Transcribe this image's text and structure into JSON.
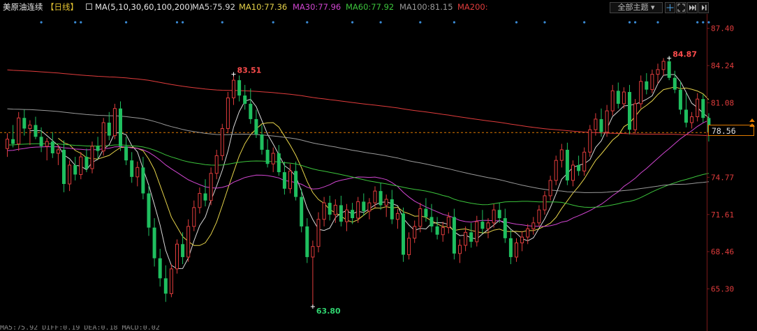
{
  "header": {
    "instrument": "美原油连续",
    "period": "【日线】",
    "ma_params": "MA(5,10,30,60,100,200)",
    "ma_values": [
      {
        "label": "MA5:75.92",
        "color": "#d8d8d8"
      },
      {
        "label": "MA10:77.36",
        "color": "#e6d34a"
      },
      {
        "label": "MA30:77.96",
        "color": "#d146d1"
      },
      {
        "label": "MA60:77.92",
        "color": "#3cc43c"
      },
      {
        "label": "MA100:81.15",
        "color": "#9a9a9a"
      },
      {
        "label": "MA200:",
        "color": "#e03c3c"
      }
    ],
    "theme_button": "全部主题",
    "theme_arrow": "▾",
    "icons": [
      "crosshair-icon",
      "expand-icon",
      "fast-forward-icon",
      "step-forward-icon"
    ]
  },
  "chart_data": {
    "type": "candlestick",
    "ylim": [
      62.5,
      88.5
    ],
    "y_ticks": [
      "87.40",
      "84.24",
      "81.08",
      "78.56",
      "74.77",
      "71.61",
      "68.46",
      "65.30"
    ],
    "last_price": "78.56",
    "high_annotation": {
      "label": "84.87",
      "index": 117,
      "value": 84.87
    },
    "high_annotation_2": {
      "label": "83.51",
      "index": 40,
      "value": 83.51
    },
    "low_annotation": {
      "label": "63.80",
      "index": 54,
      "value": 63.8
    },
    "candles": [
      {
        "o": 77.2,
        "h": 78.5,
        "l": 76.5,
        "c": 78.0
      },
      {
        "o": 78.0,
        "h": 79.2,
        "l": 77.3,
        "c": 77.6
      },
      {
        "o": 77.6,
        "h": 80.3,
        "l": 77.0,
        "c": 79.8
      },
      {
        "o": 79.8,
        "h": 80.5,
        "l": 78.3,
        "c": 78.9
      },
      {
        "o": 78.9,
        "h": 79.6,
        "l": 77.5,
        "c": 79.2
      },
      {
        "o": 79.2,
        "h": 79.9,
        "l": 78.0,
        "c": 78.2
      },
      {
        "o": 78.2,
        "h": 79.0,
        "l": 76.9,
        "c": 77.4
      },
      {
        "o": 77.4,
        "h": 78.1,
        "l": 76.2,
        "c": 77.8
      },
      {
        "o": 77.8,
        "h": 78.6,
        "l": 76.4,
        "c": 76.8
      },
      {
        "o": 76.8,
        "h": 77.5,
        "l": 75.8,
        "c": 77.1
      },
      {
        "o": 77.1,
        "h": 77.9,
        "l": 73.5,
        "c": 74.2
      },
      {
        "o": 74.2,
        "h": 76.2,
        "l": 73.6,
        "c": 75.8
      },
      {
        "o": 75.8,
        "h": 76.5,
        "l": 74.5,
        "c": 75.0
      },
      {
        "o": 75.0,
        "h": 76.9,
        "l": 74.6,
        "c": 76.5
      },
      {
        "o": 76.5,
        "h": 77.2,
        "l": 75.2,
        "c": 75.5
      },
      {
        "o": 75.5,
        "h": 77.8,
        "l": 75.1,
        "c": 77.4
      },
      {
        "o": 77.4,
        "h": 78.2,
        "l": 76.3,
        "c": 77.0
      },
      {
        "o": 77.0,
        "h": 79.8,
        "l": 76.6,
        "c": 79.4
      },
      {
        "o": 79.4,
        "h": 80.3,
        "l": 77.9,
        "c": 78.3
      },
      {
        "o": 78.3,
        "h": 81.0,
        "l": 78.0,
        "c": 80.6
      },
      {
        "o": 80.6,
        "h": 81.2,
        "l": 77.0,
        "c": 77.4
      },
      {
        "o": 77.4,
        "h": 78.2,
        "l": 75.8,
        "c": 76.2
      },
      {
        "o": 76.2,
        "h": 76.9,
        "l": 74.3,
        "c": 74.8
      },
      {
        "o": 74.8,
        "h": 76.1,
        "l": 74.0,
        "c": 75.6
      },
      {
        "o": 75.6,
        "h": 76.5,
        "l": 72.9,
        "c": 73.4
      },
      {
        "o": 73.4,
        "h": 74.1,
        "l": 69.8,
        "c": 70.5
      },
      {
        "o": 70.5,
        "h": 71.3,
        "l": 67.2,
        "c": 67.9
      },
      {
        "o": 67.9,
        "h": 68.7,
        "l": 65.5,
        "c": 66.2
      },
      {
        "o": 66.2,
        "h": 67.3,
        "l": 64.2,
        "c": 64.9
      },
      {
        "o": 64.9,
        "h": 67.4,
        "l": 64.6,
        "c": 67.0
      },
      {
        "o": 67.0,
        "h": 69.5,
        "l": 66.6,
        "c": 69.1
      },
      {
        "o": 69.1,
        "h": 70.1,
        "l": 67.4,
        "c": 68.0
      },
      {
        "o": 68.0,
        "h": 71.2,
        "l": 67.6,
        "c": 70.6
      },
      {
        "o": 70.6,
        "h": 72.8,
        "l": 70.2,
        "c": 72.2
      },
      {
        "o": 72.2,
        "h": 73.9,
        "l": 71.7,
        "c": 73.4
      },
      {
        "o": 73.4,
        "h": 74.6,
        "l": 72.3,
        "c": 72.8
      },
      {
        "o": 72.8,
        "h": 75.6,
        "l": 72.4,
        "c": 75.1
      },
      {
        "o": 75.1,
        "h": 77.1,
        "l": 74.6,
        "c": 76.6
      },
      {
        "o": 76.6,
        "h": 79.3,
        "l": 76.2,
        "c": 78.9
      },
      {
        "o": 78.9,
        "h": 82.0,
        "l": 78.5,
        "c": 81.5
      },
      {
        "o": 81.5,
        "h": 83.51,
        "l": 80.9,
        "c": 83.0
      },
      {
        "o": 83.0,
        "h": 83.4,
        "l": 81.2,
        "c": 81.7
      },
      {
        "o": 81.7,
        "h": 82.6,
        "l": 80.5,
        "c": 81.0
      },
      {
        "o": 81.0,
        "h": 82.3,
        "l": 79.3,
        "c": 79.7
      },
      {
        "o": 79.7,
        "h": 80.5,
        "l": 78.1,
        "c": 78.4
      },
      {
        "o": 78.4,
        "h": 79.2,
        "l": 76.7,
        "c": 77.1
      },
      {
        "o": 77.1,
        "h": 78.0,
        "l": 75.6,
        "c": 75.9
      },
      {
        "o": 75.9,
        "h": 77.3,
        "l": 75.2,
        "c": 76.8
      },
      {
        "o": 76.8,
        "h": 77.5,
        "l": 74.9,
        "c": 75.2
      },
      {
        "o": 75.2,
        "h": 76.1,
        "l": 73.3,
        "c": 73.8
      },
      {
        "o": 73.8,
        "h": 75.9,
        "l": 73.4,
        "c": 75.3
      },
      {
        "o": 75.3,
        "h": 76.1,
        "l": 72.8,
        "c": 73.1
      },
      {
        "o": 73.1,
        "h": 73.8,
        "l": 70.1,
        "c": 70.6
      },
      {
        "o": 70.6,
        "h": 71.3,
        "l": 67.5,
        "c": 68.0
      },
      {
        "o": 68.0,
        "h": 69.4,
        "l": 63.8,
        "c": 68.9
      },
      {
        "o": 68.9,
        "h": 71.8,
        "l": 68.4,
        "c": 71.2
      },
      {
        "o": 71.2,
        "h": 73.1,
        "l": 70.6,
        "c": 72.6
      },
      {
        "o": 72.6,
        "h": 73.2,
        "l": 71.1,
        "c": 71.6
      },
      {
        "o": 71.6,
        "h": 72.9,
        "l": 70.9,
        "c": 72.4
      },
      {
        "o": 72.4,
        "h": 73.2,
        "l": 70.6,
        "c": 71.0
      },
      {
        "o": 71.0,
        "h": 72.5,
        "l": 70.2,
        "c": 72.0
      },
      {
        "o": 72.0,
        "h": 72.6,
        "l": 70.8,
        "c": 71.3
      },
      {
        "o": 71.3,
        "h": 73.1,
        "l": 70.9,
        "c": 72.7
      },
      {
        "o": 72.7,
        "h": 73.4,
        "l": 71.5,
        "c": 71.9
      },
      {
        "o": 71.9,
        "h": 73.0,
        "l": 71.2,
        "c": 72.6
      },
      {
        "o": 72.6,
        "h": 74.0,
        "l": 72.2,
        "c": 73.6
      },
      {
        "o": 73.6,
        "h": 74.3,
        "l": 72.0,
        "c": 72.4
      },
      {
        "o": 72.4,
        "h": 73.3,
        "l": 71.4,
        "c": 72.9
      },
      {
        "o": 72.9,
        "h": 73.7,
        "l": 70.8,
        "c": 71.2
      },
      {
        "o": 71.2,
        "h": 72.1,
        "l": 70.4,
        "c": 71.7
      },
      {
        "o": 71.7,
        "h": 72.2,
        "l": 67.6,
        "c": 68.2
      },
      {
        "o": 68.2,
        "h": 70.1,
        "l": 67.8,
        "c": 69.6
      },
      {
        "o": 69.6,
        "h": 71.1,
        "l": 69.2,
        "c": 70.6
      },
      {
        "o": 70.6,
        "h": 72.6,
        "l": 70.1,
        "c": 72.1
      },
      {
        "o": 72.1,
        "h": 73.0,
        "l": 71.0,
        "c": 71.4
      },
      {
        "o": 71.4,
        "h": 72.5,
        "l": 70.1,
        "c": 70.6
      },
      {
        "o": 70.6,
        "h": 71.4,
        "l": 69.5,
        "c": 69.9
      },
      {
        "o": 69.9,
        "h": 71.0,
        "l": 69.3,
        "c": 70.5
      },
      {
        "o": 70.5,
        "h": 71.8,
        "l": 70.0,
        "c": 71.4
      },
      {
        "o": 71.4,
        "h": 72.1,
        "l": 67.8,
        "c": 68.3
      },
      {
        "o": 68.3,
        "h": 69.5,
        "l": 67.5,
        "c": 69.0
      },
      {
        "o": 69.0,
        "h": 70.6,
        "l": 68.5,
        "c": 70.1
      },
      {
        "o": 70.1,
        "h": 70.9,
        "l": 68.8,
        "c": 69.3
      },
      {
        "o": 69.3,
        "h": 71.5,
        "l": 68.9,
        "c": 71.0
      },
      {
        "o": 71.0,
        "h": 72.0,
        "l": 70.0,
        "c": 70.4
      },
      {
        "o": 70.4,
        "h": 71.3,
        "l": 69.6,
        "c": 70.9
      },
      {
        "o": 70.9,
        "h": 72.5,
        "l": 70.5,
        "c": 72.0
      },
      {
        "o": 72.0,
        "h": 72.6,
        "l": 70.9,
        "c": 71.3
      },
      {
        "o": 71.3,
        "h": 72.1,
        "l": 69.2,
        "c": 69.6
      },
      {
        "o": 69.6,
        "h": 70.3,
        "l": 67.4,
        "c": 68.0
      },
      {
        "o": 68.0,
        "h": 69.6,
        "l": 67.6,
        "c": 69.2
      },
      {
        "o": 69.2,
        "h": 70.2,
        "l": 68.5,
        "c": 69.7
      },
      {
        "o": 69.7,
        "h": 70.8,
        "l": 69.1,
        "c": 70.4
      },
      {
        "o": 70.4,
        "h": 71.4,
        "l": 69.9,
        "c": 70.9
      },
      {
        "o": 70.9,
        "h": 72.4,
        "l": 70.6,
        "c": 72.0
      },
      {
        "o": 72.0,
        "h": 73.6,
        "l": 71.6,
        "c": 73.2
      },
      {
        "o": 73.2,
        "h": 74.9,
        "l": 72.8,
        "c": 74.5
      },
      {
        "o": 74.5,
        "h": 76.6,
        "l": 74.1,
        "c": 76.2
      },
      {
        "o": 76.2,
        "h": 77.6,
        "l": 75.6,
        "c": 77.1
      },
      {
        "o": 77.1,
        "h": 77.7,
        "l": 74.1,
        "c": 74.5
      },
      {
        "o": 74.5,
        "h": 76.2,
        "l": 74.0,
        "c": 75.8
      },
      {
        "o": 75.8,
        "h": 76.6,
        "l": 74.9,
        "c": 75.3
      },
      {
        "o": 75.3,
        "h": 77.3,
        "l": 74.9,
        "c": 76.9
      },
      {
        "o": 76.9,
        "h": 79.2,
        "l": 76.5,
        "c": 78.8
      },
      {
        "o": 78.8,
        "h": 80.2,
        "l": 78.3,
        "c": 79.7
      },
      {
        "o": 79.7,
        "h": 80.6,
        "l": 78.2,
        "c": 78.6
      },
      {
        "o": 78.6,
        "h": 80.9,
        "l": 78.2,
        "c": 80.4
      },
      {
        "o": 80.4,
        "h": 82.6,
        "l": 80.0,
        "c": 82.1
      },
      {
        "o": 82.1,
        "h": 82.8,
        "l": 80.6,
        "c": 81.0
      },
      {
        "o": 81.0,
        "h": 82.4,
        "l": 80.6,
        "c": 82.0
      },
      {
        "o": 82.0,
        "h": 82.6,
        "l": 78.4,
        "c": 78.8
      },
      {
        "o": 78.8,
        "h": 81.4,
        "l": 78.5,
        "c": 81.0
      },
      {
        "o": 81.0,
        "h": 83.4,
        "l": 80.6,
        "c": 82.9
      },
      {
        "o": 82.9,
        "h": 83.6,
        "l": 81.8,
        "c": 82.2
      },
      {
        "o": 82.2,
        "h": 83.9,
        "l": 81.9,
        "c": 83.5
      },
      {
        "o": 83.5,
        "h": 84.4,
        "l": 82.7,
        "c": 83.9
      },
      {
        "o": 83.9,
        "h": 84.87,
        "l": 83.4,
        "c": 84.6
      },
      {
        "o": 84.6,
        "h": 85.0,
        "l": 83.0,
        "c": 83.2
      },
      {
        "o": 83.2,
        "h": 83.8,
        "l": 81.9,
        "c": 82.2
      },
      {
        "o": 82.2,
        "h": 82.9,
        "l": 80.1,
        "c": 80.5
      },
      {
        "o": 80.5,
        "h": 81.9,
        "l": 79.0,
        "c": 79.4
      },
      {
        "o": 79.4,
        "h": 80.3,
        "l": 78.9,
        "c": 79.9
      },
      {
        "o": 79.9,
        "h": 81.9,
        "l": 79.5,
        "c": 81.4
      },
      {
        "o": 81.4,
        "h": 81.8,
        "l": 79.4,
        "c": 79.8
      },
      {
        "o": 79.8,
        "h": 80.2,
        "l": 77.8,
        "c": 78.56
      }
    ],
    "series": [
      {
        "name": "MA5",
        "color": "#d8d8d8"
      },
      {
        "name": "MA10",
        "color": "#e6d34a"
      },
      {
        "name": "MA30",
        "color": "#d146d1"
      },
      {
        "name": "MA60",
        "color": "#3cc43c"
      },
      {
        "name": "MA100",
        "color": "#9a9a9a"
      },
      {
        "name": "MA200",
        "color": "#e03c3c"
      }
    ],
    "ma_seeds": {
      "MA30": 77.0,
      "MA60": 77.5,
      "MA100": 80.6,
      "MA200": 83.9
    },
    "marker_dots_indices": [
      6,
      12,
      13,
      21,
      30,
      31,
      38,
      47,
      53,
      61,
      66,
      73,
      79,
      90,
      95,
      102,
      110,
      111,
      115,
      122,
      123,
      124
    ],
    "colors": {
      "up": "#e03c3c",
      "down": "#1fbf5f",
      "dots": "#3a8bd6",
      "last_line": "#e07b00",
      "axis_text": "#e03c3c"
    }
  },
  "bottom_text": "MA5:75.92  DIFF:0.19  DEA:0.18  MACD:0.02"
}
